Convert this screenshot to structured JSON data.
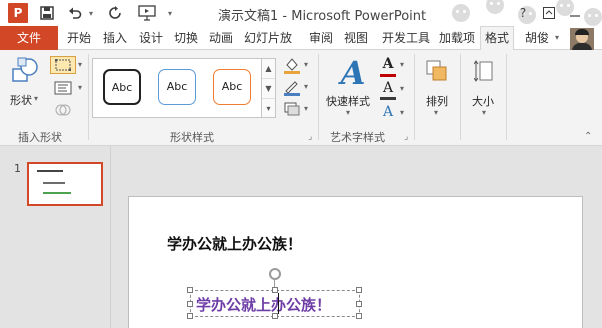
{
  "window": {
    "title": "演示文稿1 - Microsoft PowerPoint",
    "app_icon_letter": "P",
    "brand_color": "#d24726"
  },
  "quick_access": [
    "save-icon",
    "undo-icon",
    "redo-icon",
    "start-slideshow-icon",
    "customize-dropdown-icon"
  ],
  "tabs": [
    {
      "label": "文件"
    },
    {
      "label": "开始"
    },
    {
      "label": "插入"
    },
    {
      "label": "设计"
    },
    {
      "label": "切换"
    },
    {
      "label": "动画"
    },
    {
      "label": "幻灯片放"
    },
    {
      "label": "审阅"
    },
    {
      "label": "视图"
    },
    {
      "label": "开发工具"
    },
    {
      "label": "加载项"
    },
    {
      "label": "格式"
    }
  ],
  "active_tab": "格式",
  "user": {
    "name": "胡俊"
  },
  "ribbon": {
    "insert_shapes": {
      "shape_button_label": "形状",
      "group_label": "插入形状"
    },
    "shape_styles": {
      "swatches": [
        {
          "text": "Abc",
          "color": "#222222"
        },
        {
          "text": "Abc",
          "color": "#5b9bd5"
        },
        {
          "text": "Abc",
          "color": "#ed7d31"
        }
      ],
      "group_label": "形状样式"
    },
    "wordart": {
      "quick_styles_label": "快速样式",
      "group_label": "艺术字样式",
      "text_fill_color": "#c00000",
      "text_outline_color": "#3a3a3a"
    },
    "arrange": {
      "label": "排列"
    },
    "size": {
      "label": "大小"
    }
  },
  "slides_pane": {
    "slide_number": "1"
  },
  "slide": {
    "title_text": "学办公就上办公族！",
    "selected_text": "学办公就上办公族！",
    "selected_text_color": "#6e3ea6"
  }
}
